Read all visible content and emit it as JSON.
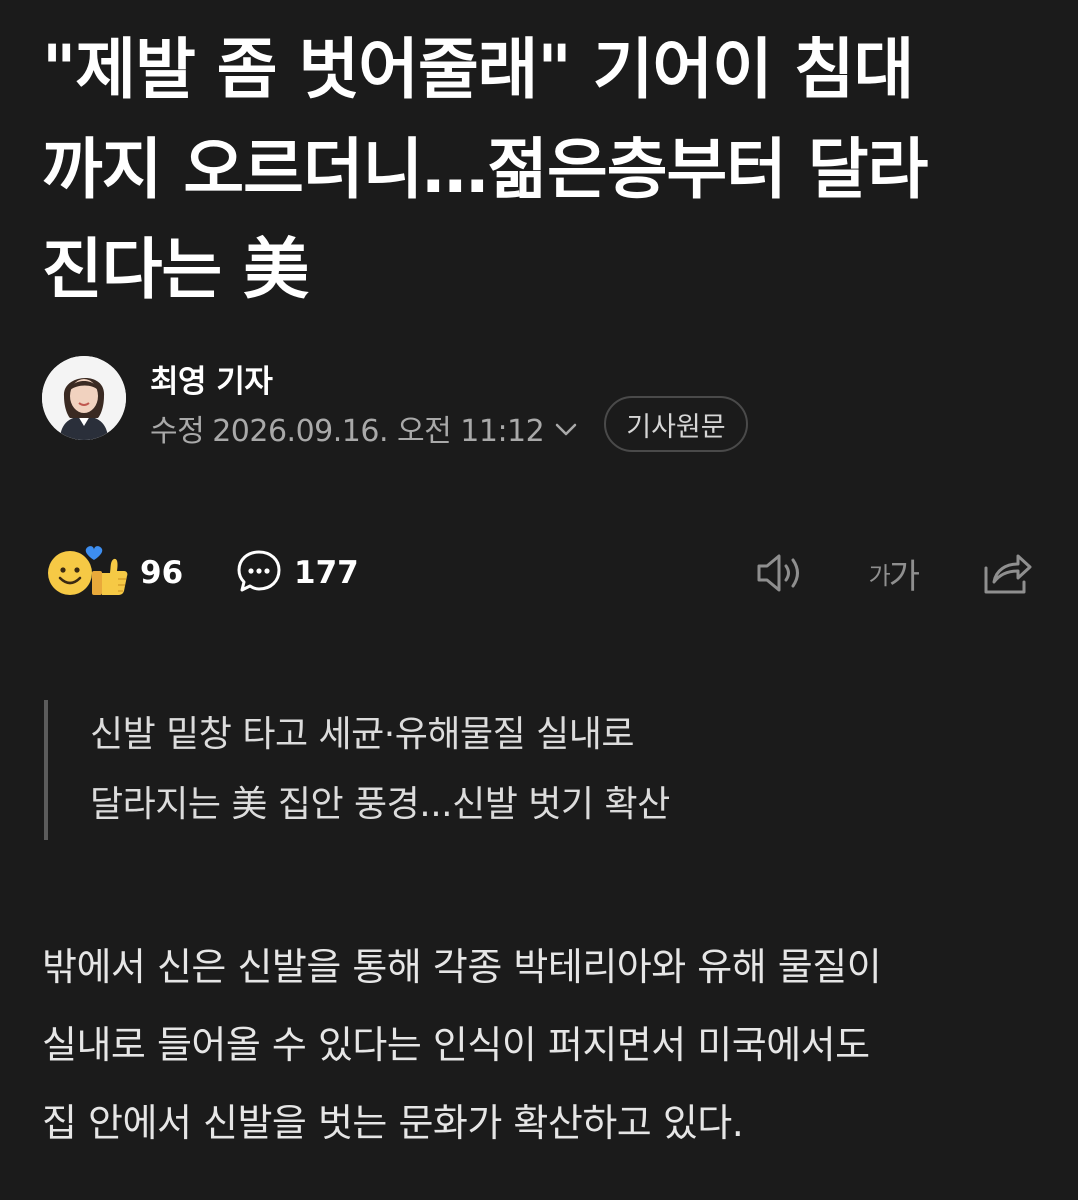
{
  "article": {
    "headline_lines": [
      "\"제발 좀 벗어줄래\" 기어이 침대",
      "까지 오르더니…젊은층부터 달라",
      "진다는 美"
    ],
    "reporter": "최영 기자",
    "updated_label": "수정",
    "updated_date": "2026.09.16. 오전 11:12",
    "original_button": "기사원문",
    "reaction_count": "96",
    "comment_count": "177",
    "font_size_label_small": "가",
    "font_size_label_large": "가",
    "summary_lines": [
      "신발 밑창 타고 세균·유해물질 실내로",
      "달라지는 美 집안 풍경...신발 벗기 확산"
    ],
    "body_lines": [
      "밖에서 신은 신발을 통해 각종 박테리아와 유해 물질이",
      "실내로 들어올 수 있다는 인식이 퍼지면서 미국에서도",
      "집 안에서 신발을 벗는 문화가 확산하고 있다."
    ]
  },
  "icons": {
    "reaction": "smile-thumbs-up-icon",
    "comment": "speech-bubble-icon",
    "listen": "speaker-icon",
    "chevron": "chevron-down-icon",
    "share": "share-icon"
  },
  "colors": {
    "background": "#1b1b1b",
    "text_primary": "#ffffff",
    "text_secondary": "#a9a9a9",
    "icon_muted": "#8f8f8f",
    "emoji_yellow": "#f6c945",
    "heart_blue": "#3d8ef0"
  }
}
